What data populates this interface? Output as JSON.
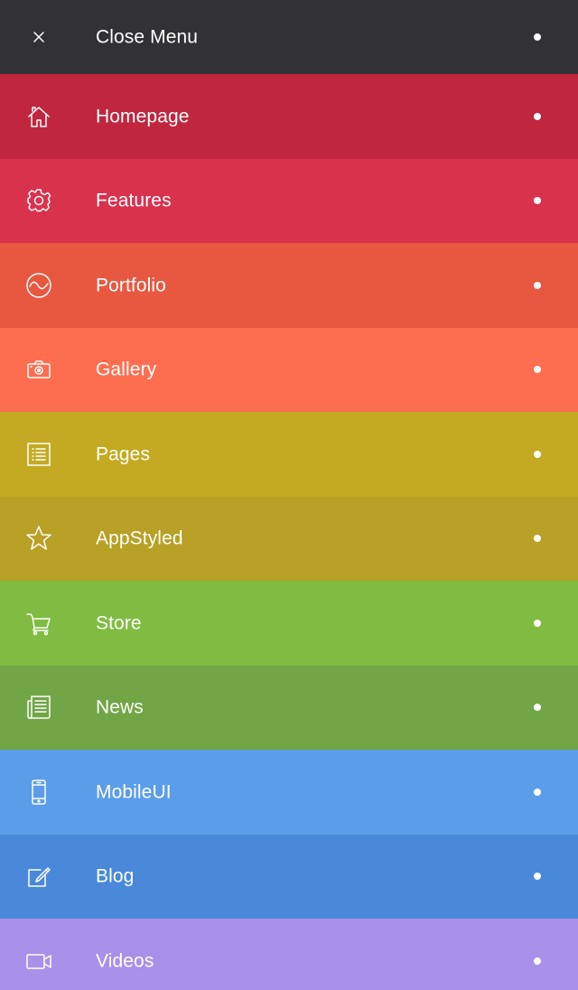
{
  "menu": {
    "close": {
      "label": "Close Menu",
      "icon": "close-icon",
      "color": "#323234"
    },
    "items": [
      {
        "label": "Homepage",
        "icon": "home-icon",
        "color": "#c0263d"
      },
      {
        "label": "Features",
        "icon": "gear-icon",
        "color": "#d9324d"
      },
      {
        "label": "Portfolio",
        "icon": "wave-circle-icon",
        "color": "#e85840"
      },
      {
        "label": "Gallery",
        "icon": "camera-icon",
        "color": "#fd6e50"
      },
      {
        "label": "Pages",
        "icon": "list-icon",
        "color": "#c4aa22"
      },
      {
        "label": "AppStyled",
        "icon": "star-icon",
        "color": "#b9a026"
      },
      {
        "label": "Store",
        "icon": "cart-icon",
        "color": "#80bc41"
      },
      {
        "label": "News",
        "icon": "newspaper-icon",
        "color": "#71a546"
      },
      {
        "label": "MobileUI",
        "icon": "phone-icon",
        "color": "#5b9de9"
      },
      {
        "label": "Blog",
        "icon": "edit-icon",
        "color": "#4a89d9"
      },
      {
        "label": "Videos",
        "icon": "video-icon",
        "color": "#a990e8"
      }
    ]
  }
}
